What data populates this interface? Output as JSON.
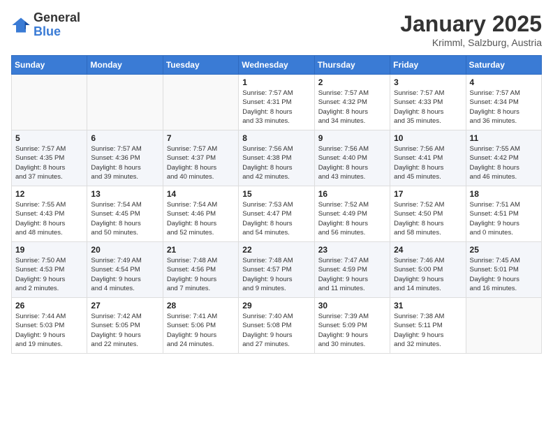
{
  "header": {
    "logo_general": "General",
    "logo_blue": "Blue",
    "month_title": "January 2025",
    "location": "Krimml, Salzburg, Austria"
  },
  "days_of_week": [
    "Sunday",
    "Monday",
    "Tuesday",
    "Wednesday",
    "Thursday",
    "Friday",
    "Saturday"
  ],
  "weeks": [
    [
      {
        "day": "",
        "info": ""
      },
      {
        "day": "",
        "info": ""
      },
      {
        "day": "",
        "info": ""
      },
      {
        "day": "1",
        "info": "Sunrise: 7:57 AM\nSunset: 4:31 PM\nDaylight: 8 hours\nand 33 minutes."
      },
      {
        "day": "2",
        "info": "Sunrise: 7:57 AM\nSunset: 4:32 PM\nDaylight: 8 hours\nand 34 minutes."
      },
      {
        "day": "3",
        "info": "Sunrise: 7:57 AM\nSunset: 4:33 PM\nDaylight: 8 hours\nand 35 minutes."
      },
      {
        "day": "4",
        "info": "Sunrise: 7:57 AM\nSunset: 4:34 PM\nDaylight: 8 hours\nand 36 minutes."
      }
    ],
    [
      {
        "day": "5",
        "info": "Sunrise: 7:57 AM\nSunset: 4:35 PM\nDaylight: 8 hours\nand 37 minutes."
      },
      {
        "day": "6",
        "info": "Sunrise: 7:57 AM\nSunset: 4:36 PM\nDaylight: 8 hours\nand 39 minutes."
      },
      {
        "day": "7",
        "info": "Sunrise: 7:57 AM\nSunset: 4:37 PM\nDaylight: 8 hours\nand 40 minutes."
      },
      {
        "day": "8",
        "info": "Sunrise: 7:56 AM\nSunset: 4:38 PM\nDaylight: 8 hours\nand 42 minutes."
      },
      {
        "day": "9",
        "info": "Sunrise: 7:56 AM\nSunset: 4:40 PM\nDaylight: 8 hours\nand 43 minutes."
      },
      {
        "day": "10",
        "info": "Sunrise: 7:56 AM\nSunset: 4:41 PM\nDaylight: 8 hours\nand 45 minutes."
      },
      {
        "day": "11",
        "info": "Sunrise: 7:55 AM\nSunset: 4:42 PM\nDaylight: 8 hours\nand 46 minutes."
      }
    ],
    [
      {
        "day": "12",
        "info": "Sunrise: 7:55 AM\nSunset: 4:43 PM\nDaylight: 8 hours\nand 48 minutes."
      },
      {
        "day": "13",
        "info": "Sunrise: 7:54 AM\nSunset: 4:45 PM\nDaylight: 8 hours\nand 50 minutes."
      },
      {
        "day": "14",
        "info": "Sunrise: 7:54 AM\nSunset: 4:46 PM\nDaylight: 8 hours\nand 52 minutes."
      },
      {
        "day": "15",
        "info": "Sunrise: 7:53 AM\nSunset: 4:47 PM\nDaylight: 8 hours\nand 54 minutes."
      },
      {
        "day": "16",
        "info": "Sunrise: 7:52 AM\nSunset: 4:49 PM\nDaylight: 8 hours\nand 56 minutes."
      },
      {
        "day": "17",
        "info": "Sunrise: 7:52 AM\nSunset: 4:50 PM\nDaylight: 8 hours\nand 58 minutes."
      },
      {
        "day": "18",
        "info": "Sunrise: 7:51 AM\nSunset: 4:51 PM\nDaylight: 9 hours\nand 0 minutes."
      }
    ],
    [
      {
        "day": "19",
        "info": "Sunrise: 7:50 AM\nSunset: 4:53 PM\nDaylight: 9 hours\nand 2 minutes."
      },
      {
        "day": "20",
        "info": "Sunrise: 7:49 AM\nSunset: 4:54 PM\nDaylight: 9 hours\nand 4 minutes."
      },
      {
        "day": "21",
        "info": "Sunrise: 7:48 AM\nSunset: 4:56 PM\nDaylight: 9 hours\nand 7 minutes."
      },
      {
        "day": "22",
        "info": "Sunrise: 7:48 AM\nSunset: 4:57 PM\nDaylight: 9 hours\nand 9 minutes."
      },
      {
        "day": "23",
        "info": "Sunrise: 7:47 AM\nSunset: 4:59 PM\nDaylight: 9 hours\nand 11 minutes."
      },
      {
        "day": "24",
        "info": "Sunrise: 7:46 AM\nSunset: 5:00 PM\nDaylight: 9 hours\nand 14 minutes."
      },
      {
        "day": "25",
        "info": "Sunrise: 7:45 AM\nSunset: 5:01 PM\nDaylight: 9 hours\nand 16 minutes."
      }
    ],
    [
      {
        "day": "26",
        "info": "Sunrise: 7:44 AM\nSunset: 5:03 PM\nDaylight: 9 hours\nand 19 minutes."
      },
      {
        "day": "27",
        "info": "Sunrise: 7:42 AM\nSunset: 5:05 PM\nDaylight: 9 hours\nand 22 minutes."
      },
      {
        "day": "28",
        "info": "Sunrise: 7:41 AM\nSunset: 5:06 PM\nDaylight: 9 hours\nand 24 minutes."
      },
      {
        "day": "29",
        "info": "Sunrise: 7:40 AM\nSunset: 5:08 PM\nDaylight: 9 hours\nand 27 minutes."
      },
      {
        "day": "30",
        "info": "Sunrise: 7:39 AM\nSunset: 5:09 PM\nDaylight: 9 hours\nand 30 minutes."
      },
      {
        "day": "31",
        "info": "Sunrise: 7:38 AM\nSunset: 5:11 PM\nDaylight: 9 hours\nand 32 minutes."
      },
      {
        "day": "",
        "info": ""
      }
    ]
  ]
}
